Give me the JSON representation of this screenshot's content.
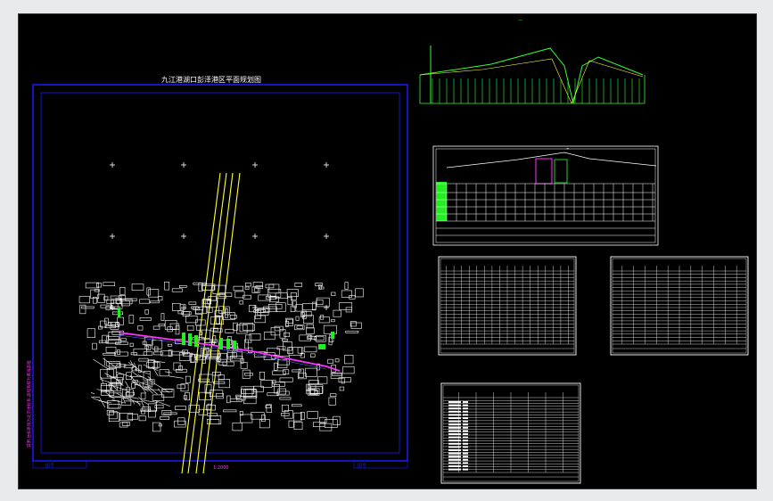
{
  "drawing": {
    "plan_title": "九江港湖口彭泽港区平面规划图",
    "scale_label": "1:2000",
    "frame_color": "#1a1aff",
    "road_color": "#ffff33",
    "pipeline_color": "#ff33ff",
    "building_color": "#ffffff",
    "profile_color": "#33ff33",
    "sheet_color": "#ffffff",
    "side_note": "说明:坐标系统为北京坐标系,高程系统为黄海高程",
    "sheet_stamp": "图号"
  }
}
